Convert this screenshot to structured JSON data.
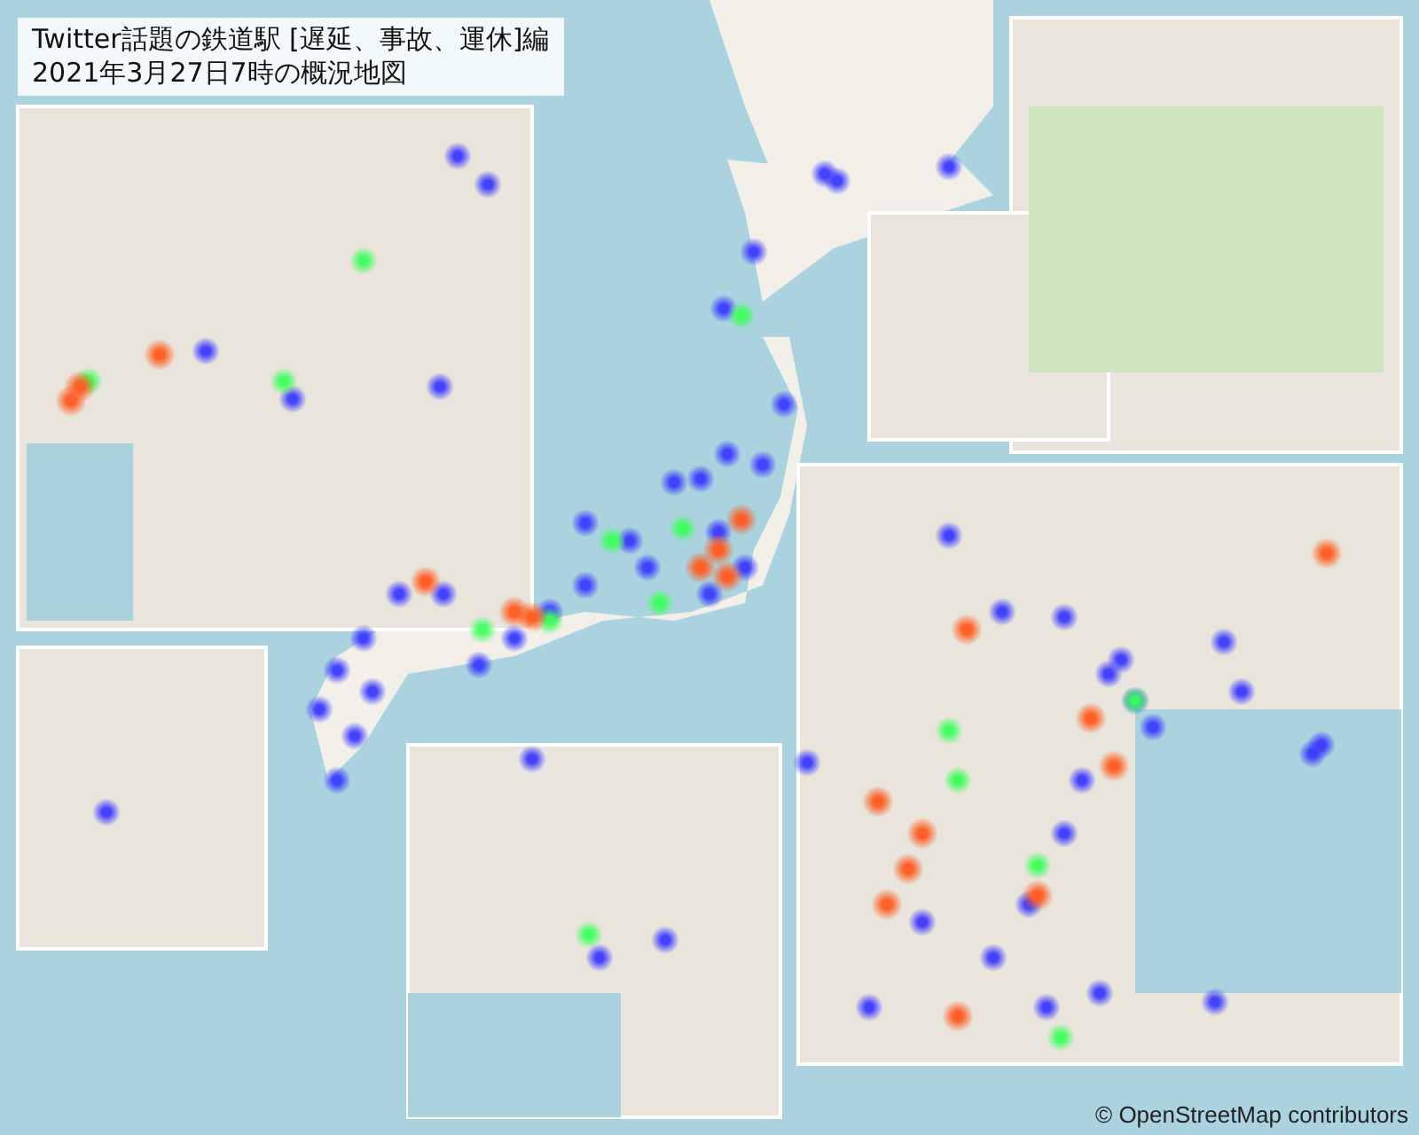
{
  "title": {
    "lines": [
      "Twitter話題の鉄道駅 [遅延、事故、運休]編",
      "2021年3月27日7時の概況地図"
    ]
  },
  "attribution": "© OpenStreetMap contributors"
}
